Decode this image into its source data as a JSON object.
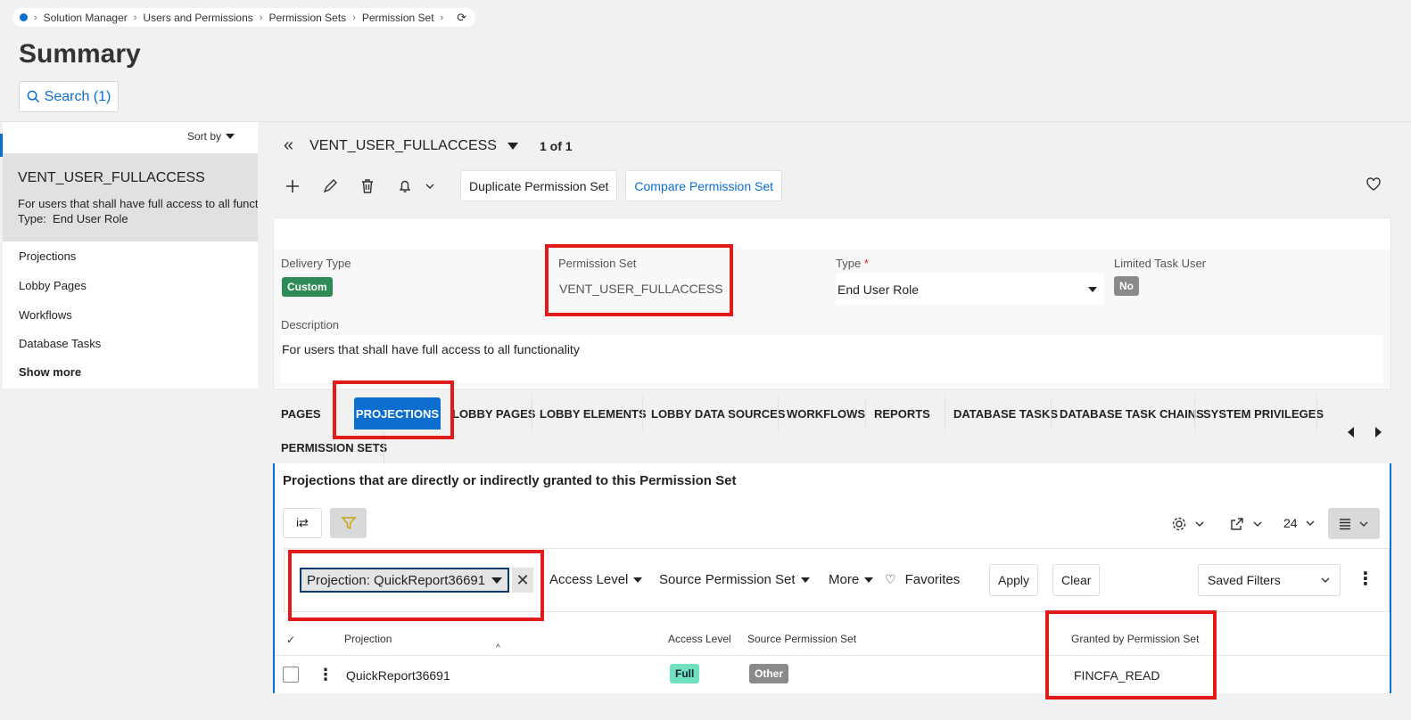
{
  "breadcrumb": {
    "items": [
      "Solution Manager",
      "Users and Permissions",
      "Permission Sets",
      "Permission Set"
    ]
  },
  "page": {
    "title": "Summary",
    "search_label": "Search (1)"
  },
  "sidebar": {
    "sort_label": "Sort by",
    "record": {
      "title": "VENT_USER_FULLACCESS",
      "description": "For users that shall have full access to all functionality",
      "type_label": "Type:",
      "type_value": "End User Role"
    },
    "items": [
      {
        "label": "Projections"
      },
      {
        "label": "Lobby Pages"
      },
      {
        "label": "Workflows"
      },
      {
        "label": "Database Tasks"
      }
    ],
    "show_more": "Show more"
  },
  "header": {
    "record_name": "VENT_USER_FULLACCESS",
    "count": "1 of 1"
  },
  "toolbar": {
    "duplicate_label": "Duplicate Permission Set",
    "compare_label": "Compare Permission Set"
  },
  "fields": {
    "delivery_type": {
      "label": "Delivery Type",
      "value": "Custom",
      "color": "#2e8b57"
    },
    "permission_set": {
      "label": "Permission Set",
      "value": "VENT_USER_FULLACCESS"
    },
    "type": {
      "label": "Type",
      "required": "*",
      "value": "End User Role"
    },
    "limited_task_user": {
      "label": "Limited Task User",
      "value": "No",
      "color": "#8a8a8a"
    },
    "description": {
      "label": "Description",
      "value": "For users that shall have full access to all functionality"
    }
  },
  "tabs": [
    {
      "label": "PAGES"
    },
    {
      "label": "PROJECTIONS"
    },
    {
      "label": "LOBBY PAGES"
    },
    {
      "label": "LOBBY ELEMENTS"
    },
    {
      "label": "LOBBY DATA SOURCES"
    },
    {
      "label": "WORKFLOWS"
    },
    {
      "label": "REPORTS"
    },
    {
      "label": "DATABASE TASKS"
    },
    {
      "label": "DATABASE TASK CHAINS"
    },
    {
      "label": "SYSTEM PRIVILEGES"
    },
    {
      "label": "PERMISSION SETS"
    }
  ],
  "grid": {
    "title": "Projections that are directly or indirectly granted to this Permission Set",
    "page_size": "24",
    "filters": {
      "chip": "Projection: QuickReport36691",
      "access_level": "Access Level",
      "source_permission_set": "Source Permission Set",
      "more": "More",
      "favorites": "Favorites",
      "apply": "Apply",
      "clear": "Clear",
      "saved_filters": "Saved Filters"
    },
    "columns": [
      "Projection",
      "Access Level",
      "Source Permission Set",
      "Granted by Permission Set"
    ],
    "rows": [
      {
        "projection": "QuickReport36691",
        "access_level": "Full",
        "source": "Other",
        "granted_by": "FINCFA_READ"
      }
    ],
    "badge_colors": {
      "full": "#6fe0c0",
      "other": "#8a8a8a"
    }
  }
}
